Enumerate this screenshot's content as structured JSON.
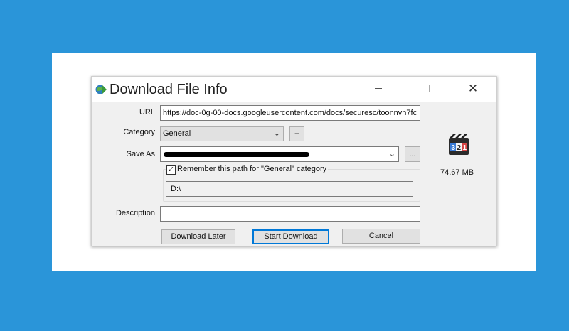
{
  "window": {
    "title": "Download File Info",
    "minimize_glyph": "minimize",
    "maximize_glyph": "maximize",
    "close_glyph": "✕"
  },
  "form": {
    "url_label": "URL",
    "url_value": "https://doc-0g-00-docs.googleusercontent.com/docs/securesc/toonnvh7fc",
    "category_label": "Category",
    "category_value": "General",
    "add_category": "+",
    "save_as_label": "Save As",
    "save_as_value": "",
    "browse_label": "...",
    "remember_checked": true,
    "remember_label": "Remember this path for \"General\" category",
    "remember_path": "D:\\",
    "description_label": "Description",
    "description_value": ""
  },
  "file": {
    "icon": "media-player-321-icon",
    "size": "74.67  MB"
  },
  "buttons": {
    "download_later": "Download Later",
    "start_download": "Start Download",
    "cancel": "Cancel"
  },
  "colors": {
    "background": "#2a95d9",
    "accent": "#0078d7"
  }
}
